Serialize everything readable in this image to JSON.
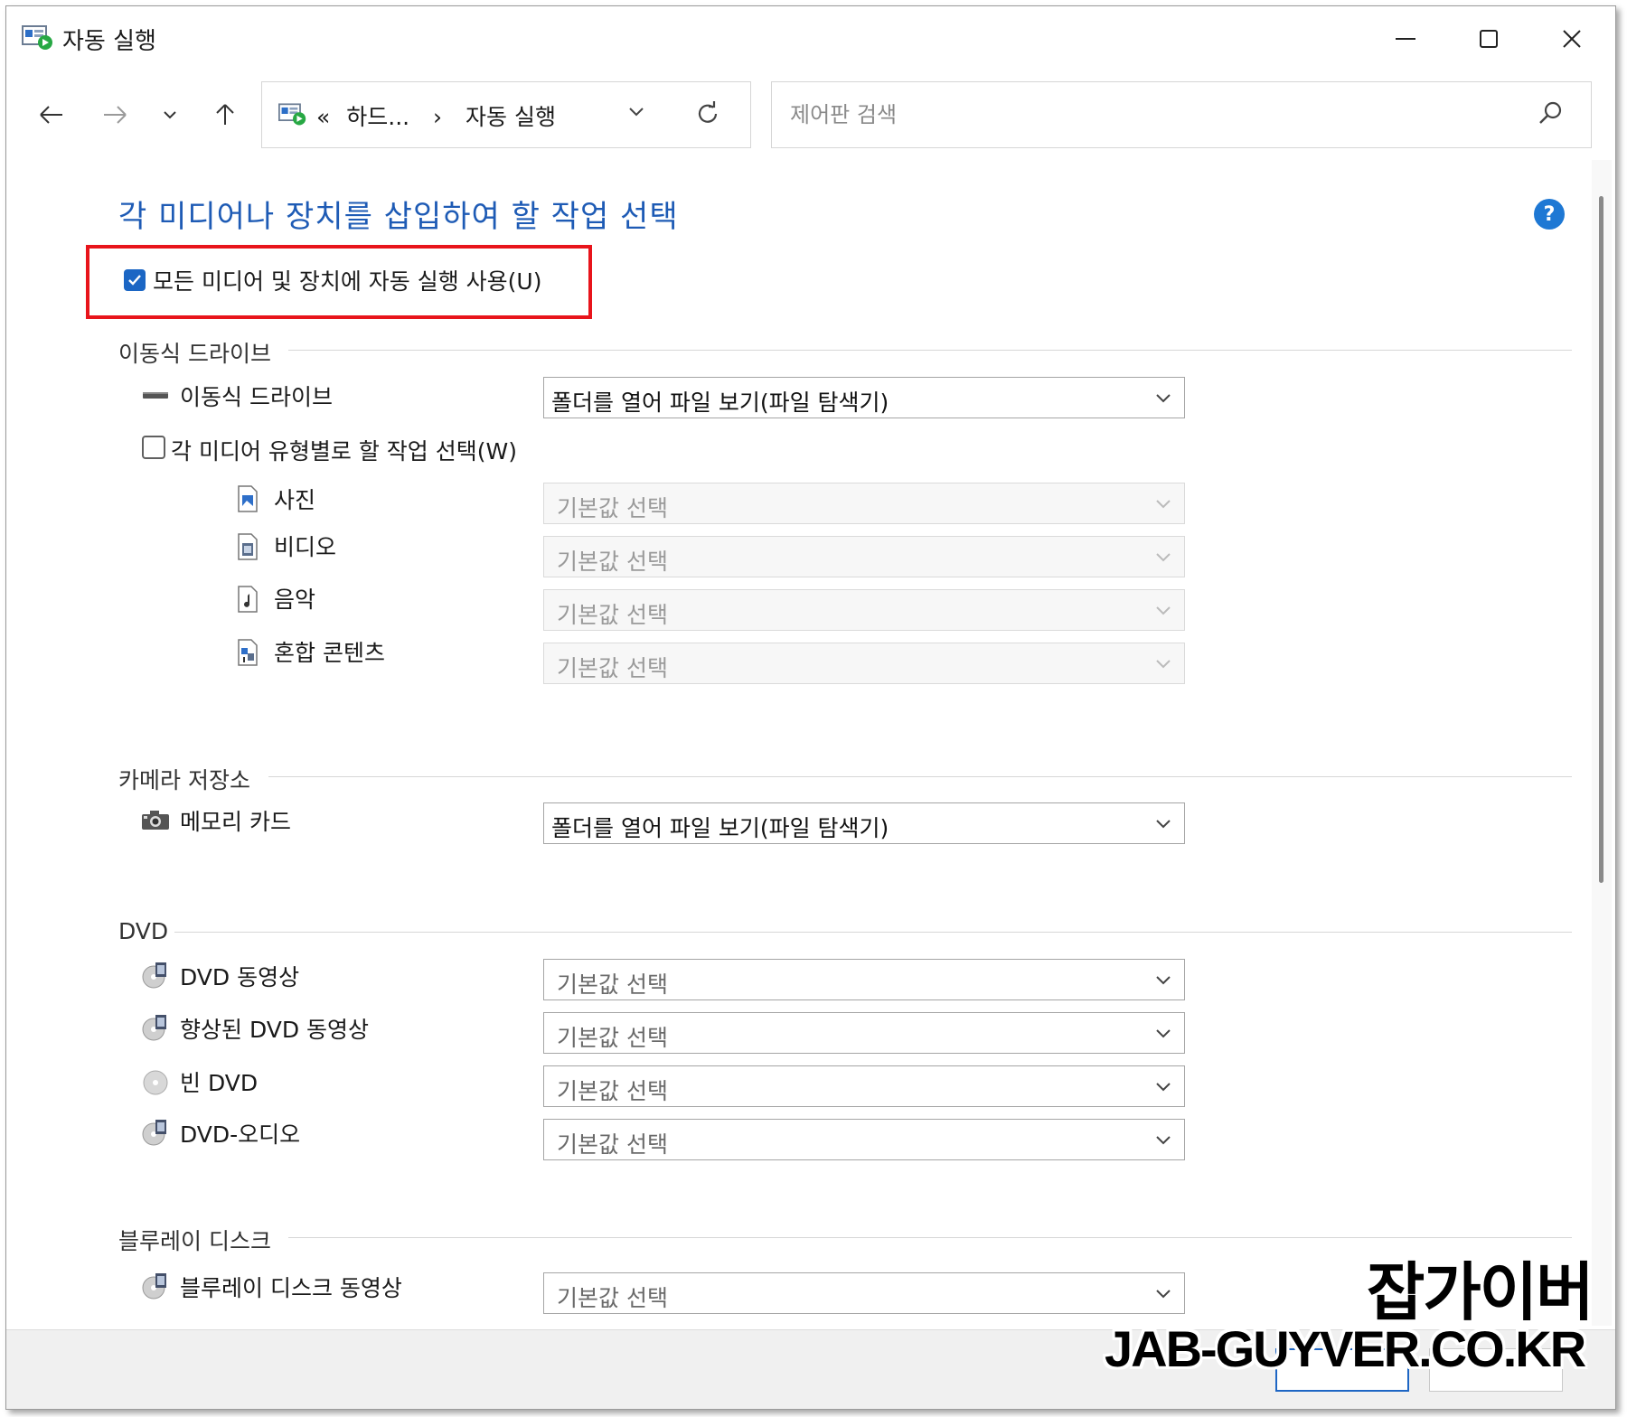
{
  "window": {
    "title": "자동 실행",
    "icon": "autoplay-icon"
  },
  "address": {
    "crumbs": [
      "«",
      "하드...",
      "›",
      "자동 실행"
    ],
    "search_placeholder": "제어판 검색"
  },
  "heading": "각 미디어나 장치를 삽입하여 할 작업 선택",
  "use_autoplay": {
    "label": "모든 미디어 및 장치에 자동 실행 사용(U)",
    "checked": true
  },
  "removable": {
    "section": "이동식 드라이브",
    "drive": {
      "label": "이동식 드라이브",
      "value": "폴더를 열어 파일 보기(파일 탐색기)"
    },
    "per_type": {
      "label": "각 미디어 유형별로 할 작업 선택(W)",
      "checked": false
    },
    "types": [
      {
        "label": "사진",
        "value": "기본값 선택",
        "icon": "picture-file-icon"
      },
      {
        "label": "비디오",
        "value": "기본값 선택",
        "icon": "video-file-icon"
      },
      {
        "label": "음악",
        "value": "기본값 선택",
        "icon": "music-file-icon"
      },
      {
        "label": "혼합 콘텐츠",
        "value": "기본값 선택",
        "icon": "mixed-content-icon"
      }
    ]
  },
  "camera": {
    "section": "카메라 저장소",
    "memory_card": {
      "label": "메모리 카드",
      "value": "폴더를 열어 파일 보기(파일 탐색기)"
    }
  },
  "dvd": {
    "section": "DVD",
    "items": [
      {
        "label": "DVD 동영상",
        "value": "기본값 선택",
        "icon": "dvd-movie-icon"
      },
      {
        "label": "향상된 DVD 동영상",
        "value": "기본값 선택",
        "icon": "dvd-movie-icon"
      },
      {
        "label": "빈 DVD",
        "value": "기본값 선택",
        "icon": "blank-disc-icon"
      },
      {
        "label": "DVD-오디오",
        "value": "기본값 선택",
        "icon": "dvd-audio-icon"
      }
    ]
  },
  "bluray": {
    "section": "블루레이 디스크",
    "items": [
      {
        "label": "블루레이 디스크 동영상",
        "value": "기본값 선택",
        "icon": "bluray-movie-icon"
      }
    ]
  },
  "watermark": {
    "line1": "잡가이버",
    "line2": "JAB-GUYVER.CO.KR"
  },
  "colors": {
    "accent": "#1b66c4",
    "heading": "#1e5bb5",
    "highlight": "#e8141b"
  }
}
